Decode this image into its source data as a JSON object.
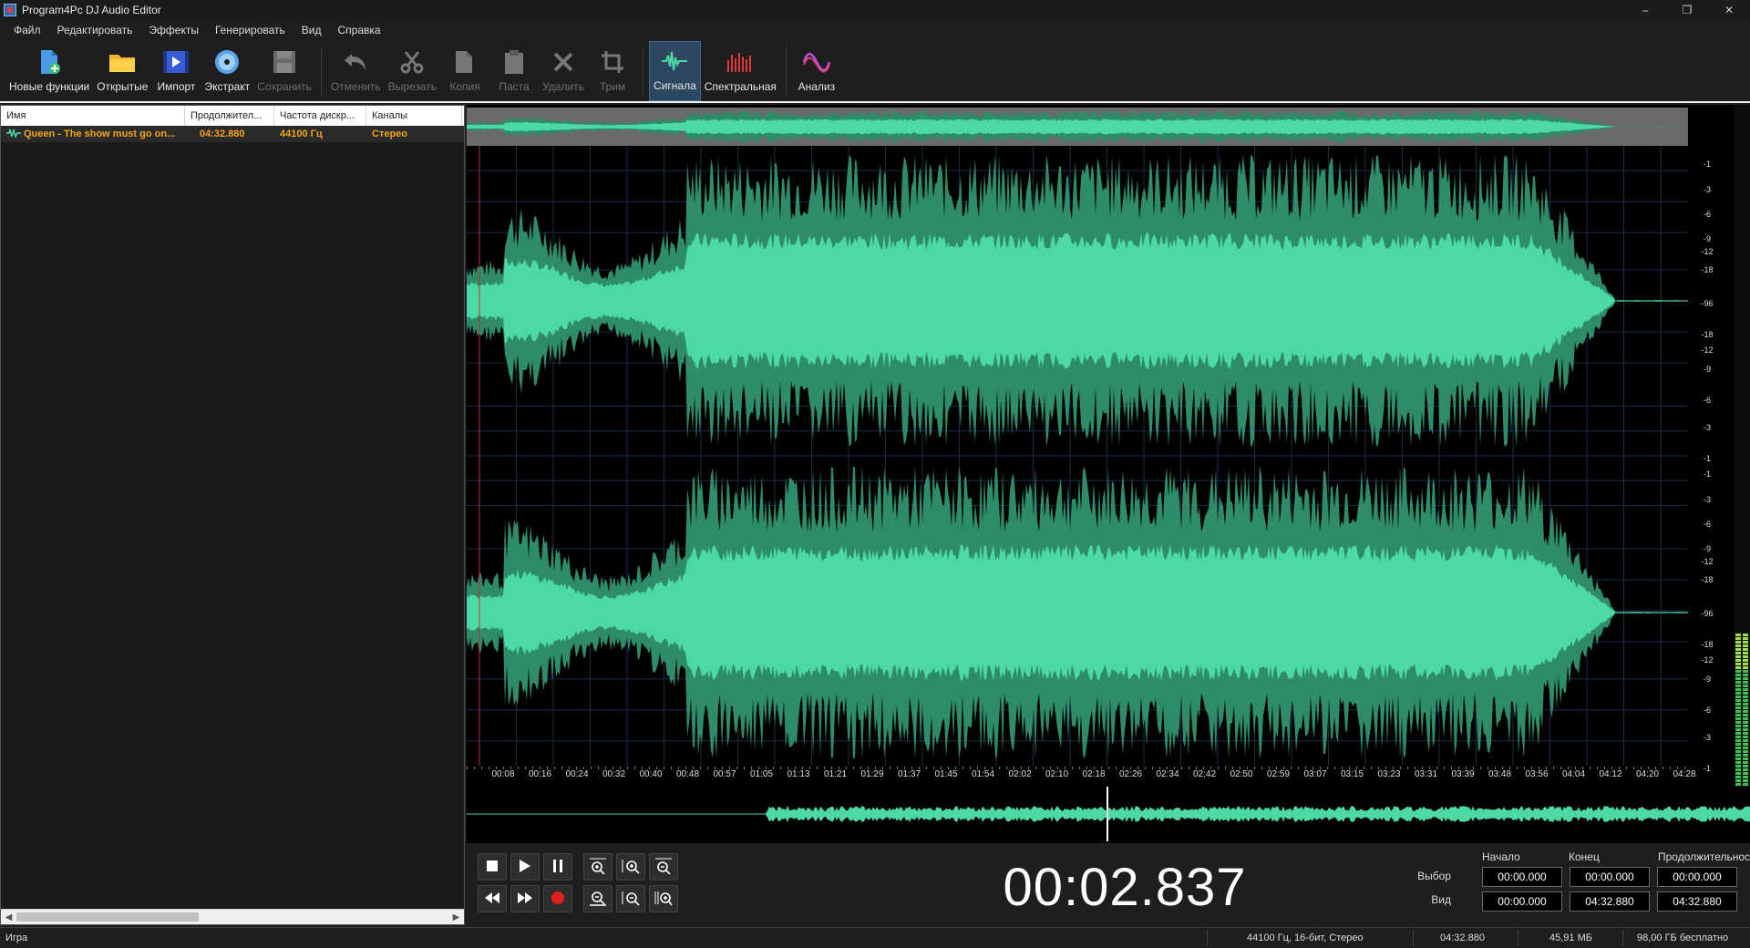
{
  "window": {
    "title": "Program4Pc DJ Audio Editor",
    "controls": [
      "–",
      "❐",
      "✕"
    ]
  },
  "menu": [
    "Файл",
    "Редактировать",
    "Эффекты",
    "Генерировать",
    "Вид",
    "Справка"
  ],
  "toolbar": [
    {
      "label": "Новые функции",
      "icon": "new-file-icon",
      "disabled": false
    },
    {
      "label": "Открытые",
      "icon": "folder-icon",
      "disabled": false
    },
    {
      "label": "Импорт",
      "icon": "film-icon",
      "disabled": false
    },
    {
      "label": "Экстракт",
      "icon": "disc-icon",
      "disabled": false
    },
    {
      "label": "Сохранить",
      "icon": "save-icon",
      "disabled": true
    },
    {
      "label": "Отменить",
      "icon": "undo-icon",
      "disabled": true
    },
    {
      "label": "Вырезать",
      "icon": "scissors-icon",
      "disabled": true
    },
    {
      "label": "Копия",
      "icon": "copy-icon",
      "disabled": true
    },
    {
      "label": "Паста",
      "icon": "paste-icon",
      "disabled": true
    },
    {
      "label": "Удалить",
      "icon": "delete-icon",
      "disabled": true
    },
    {
      "label": "Трим",
      "icon": "crop-icon",
      "disabled": true
    },
    {
      "label": "Сигнала",
      "icon": "waveform-icon",
      "disabled": false,
      "active": true
    },
    {
      "label": "Спектральная",
      "icon": "spectrum-icon",
      "disabled": false
    },
    {
      "label": "Анализ",
      "icon": "analysis-icon",
      "disabled": false
    }
  ],
  "filelist": {
    "columns": [
      "Имя",
      "Продолжител...",
      "Частота дискр...",
      "Каналы"
    ],
    "rows": [
      {
        "name": "Queen - The show must go on...",
        "duration": "04:32.880",
        "rate": "44100 Гц",
        "channels": "Стерео"
      }
    ]
  },
  "waveform": {
    "color": "#4cd9a3",
    "dark_color": "#2e8c68",
    "timeline": [
      "00:08",
      "00:16",
      "00:24",
      "00:32",
      "00:40",
      "00:48",
      "00:57",
      "01:05",
      "01:13",
      "01:21",
      "01:29",
      "01:37",
      "01:45",
      "01:54",
      "02:02",
      "02:10",
      "02:18",
      "02:26",
      "02:34",
      "02:42",
      "02:50",
      "02:59",
      "03:07",
      "03:15",
      "03:23",
      "03:31",
      "03:39",
      "03:48",
      "03:56",
      "04:04",
      "04:12",
      "04:20",
      "04:28"
    ],
    "db_scale": [
      "-1",
      "-3",
      "-6",
      "-9",
      "-12",
      "-18",
      "-96",
      "-18",
      "-12",
      "-9",
      "-6",
      "-3",
      "-1"
    ]
  },
  "transport": {
    "time": "00:02.837",
    "selection": {
      "headers": [
        "Начало",
        "Конец",
        "Продолжительнос"
      ],
      "rows": [
        {
          "label": "Выбор",
          "start": "00:00.000",
          "end": "00:00.000",
          "duration": "00:00.000"
        },
        {
          "label": "Вид",
          "start": "00:00.000",
          "end": "04:32.880",
          "duration": "04:32.880"
        }
      ]
    }
  },
  "status": {
    "mode": "Игра",
    "format": "44100 Гц, 16-бит, Стерео",
    "length": "04:32.880",
    "size": "45,91 МБ",
    "free": "98,00 ГБ бесплатно"
  }
}
